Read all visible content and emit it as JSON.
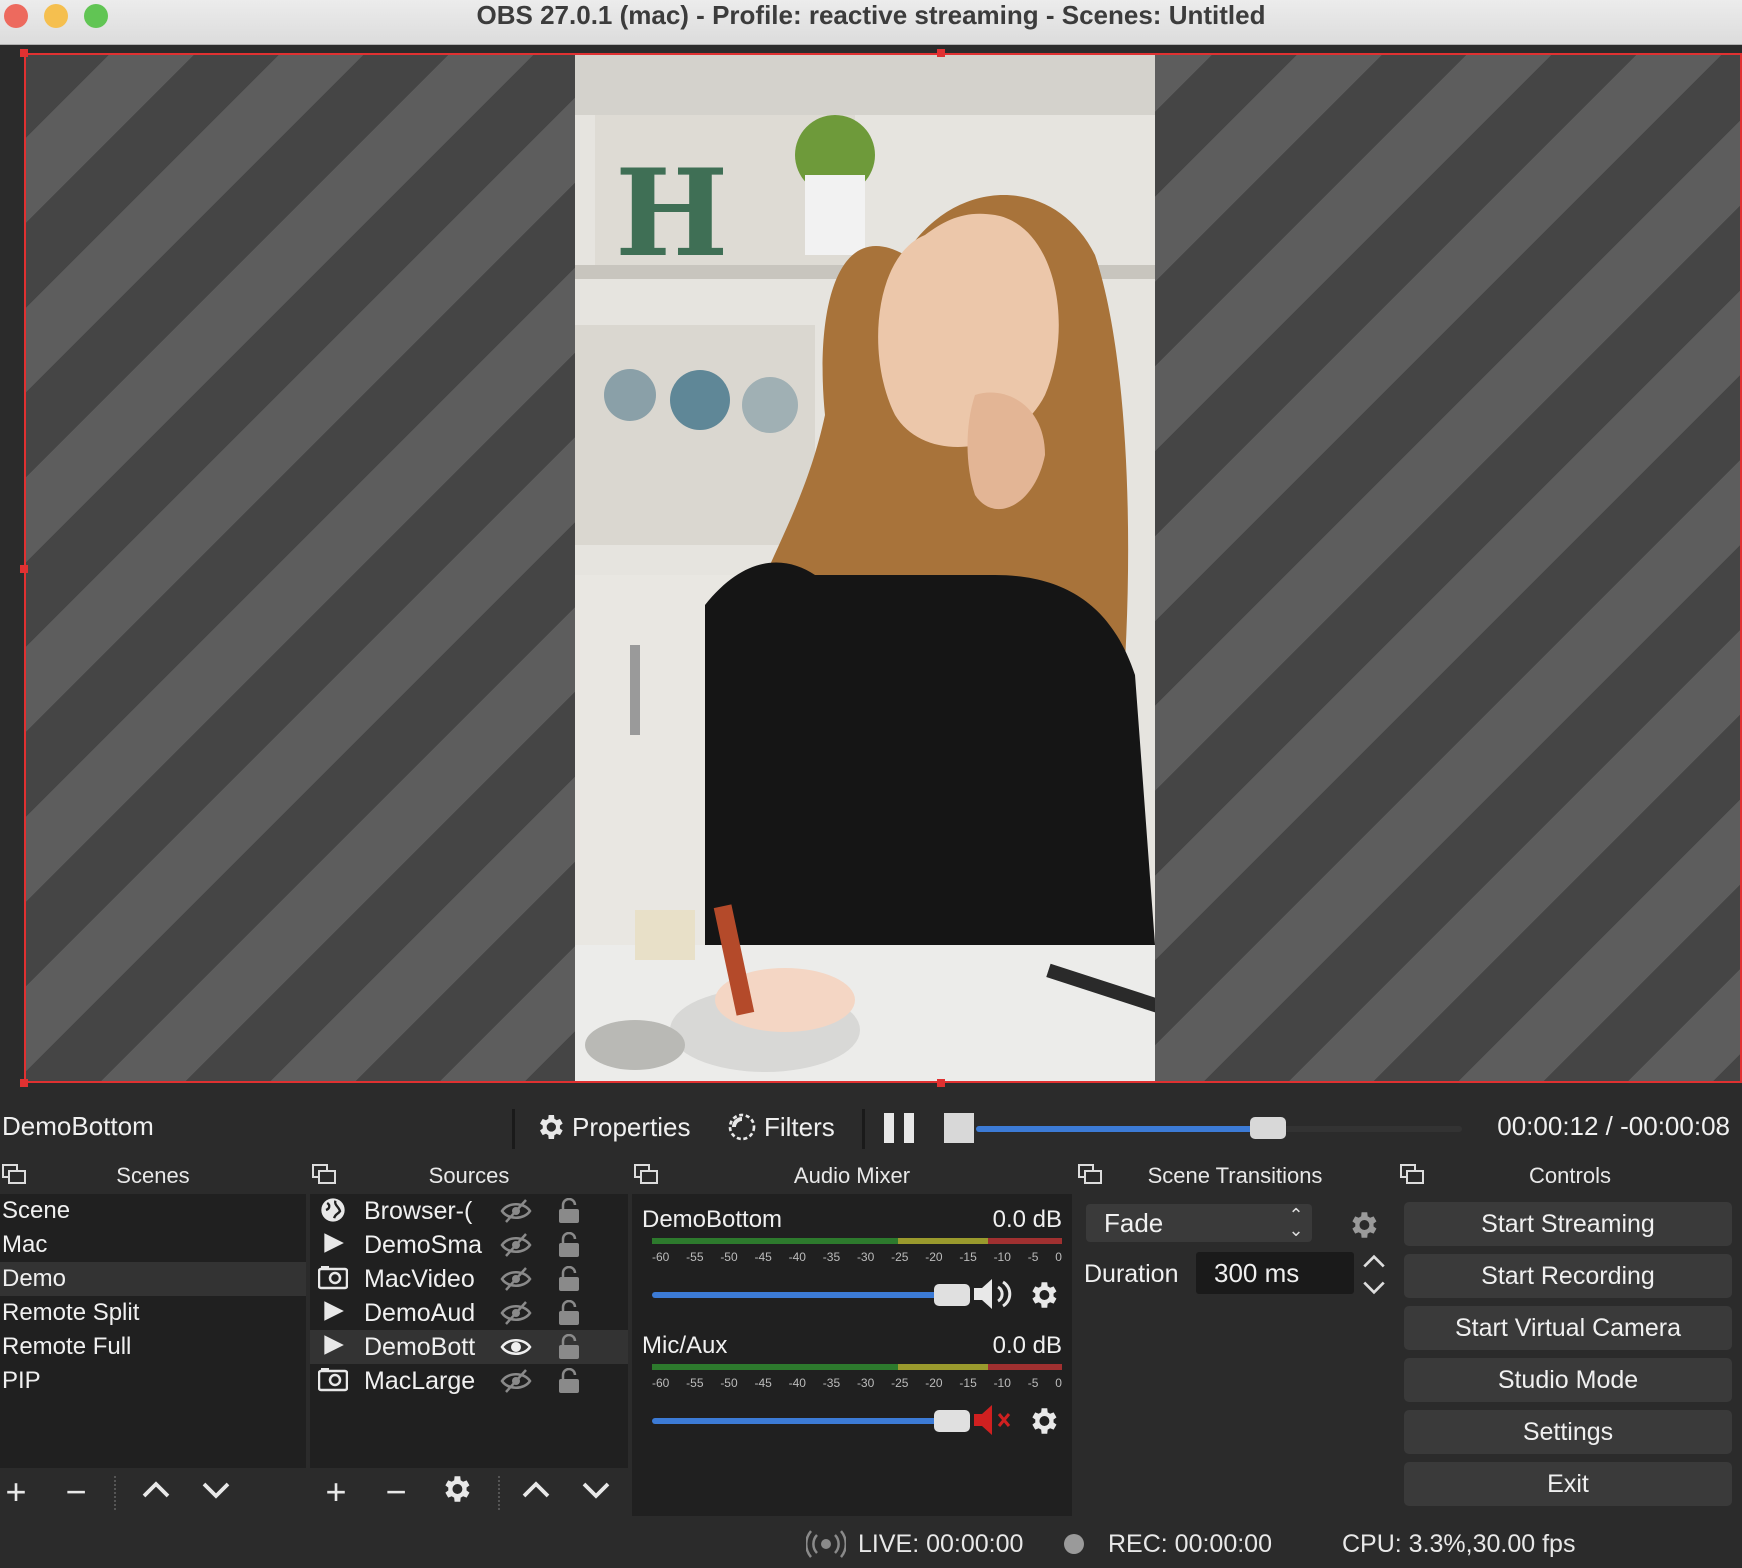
{
  "window": {
    "title": "OBS 27.0.1 (mac) - Profile: reactive streaming - Scenes: Untitled"
  },
  "source_toolbar": {
    "current_source": "DemoBottom",
    "properties_label": "Properties",
    "filters_label": "Filters",
    "timecode": "00:00:12 / -00:00:08",
    "media_progress_percent": 60
  },
  "scenes": {
    "title": "Scenes",
    "items": [
      "Scene",
      "Mac",
      "Demo",
      "Remote Split",
      "Remote Full",
      "PIP"
    ],
    "selected": "Demo"
  },
  "sources": {
    "title": "Sources",
    "items": [
      {
        "name": "Browser-(",
        "icon": "globe-icon",
        "visible": false,
        "locked": true
      },
      {
        "name": "DemoSma",
        "icon": "play-icon",
        "visible": false,
        "locked": true
      },
      {
        "name": "MacVideo",
        "icon": "camera-icon",
        "visible": false,
        "locked": true
      },
      {
        "name": "DemoAud",
        "icon": "play-icon",
        "visible": false,
        "locked": true
      },
      {
        "name": "DemoBott",
        "icon": "play-icon",
        "visible": true,
        "locked": true
      },
      {
        "name": "MacLarge",
        "icon": "camera-icon",
        "visible": false,
        "locked": true
      }
    ],
    "selected": "DemoBott"
  },
  "audio_mixer": {
    "title": "Audio Mixer",
    "ticks": [
      "-60",
      "-55",
      "-50",
      "-45",
      "-40",
      "-35",
      "-30",
      "-25",
      "-20",
      "-15",
      "-10",
      "-5",
      "0"
    ],
    "channels": [
      {
        "name": "DemoBottom",
        "db": "0.0 dB",
        "muted": false,
        "volume_percent": 100
      },
      {
        "name": "Mic/Aux",
        "db": "0.0 dB",
        "muted": true,
        "volume_percent": 100
      }
    ]
  },
  "scene_transitions": {
    "title": "Scene Transitions",
    "transition": "Fade",
    "duration_label": "Duration",
    "duration_value": "300 ms"
  },
  "controls": {
    "title": "Controls",
    "buttons": [
      "Start Streaming",
      "Start Recording",
      "Start Virtual Camera",
      "Studio Mode",
      "Settings",
      "Exit"
    ]
  },
  "status_bar": {
    "live": "LIVE: 00:00:00",
    "rec": "REC: 00:00:00",
    "cpu": "CPU: 3.3%,30.00 fps"
  },
  "colors": {
    "accent": "#3c7bd6",
    "selection": "#e03131",
    "muted": "#d02020"
  }
}
